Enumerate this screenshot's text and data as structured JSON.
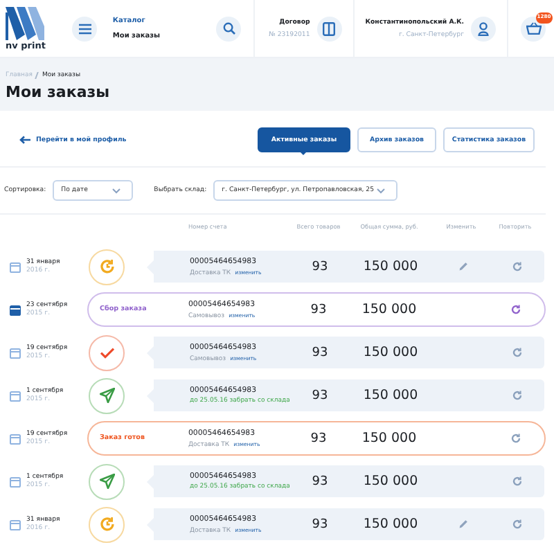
{
  "header": {
    "logo_text": "nv print",
    "nav_link": "Каталог",
    "nav_title": "Мои заказы",
    "contract": {
      "label": "Договор",
      "number": "№ 23192011"
    },
    "user": {
      "name": "Константинопольский А.К.",
      "city": "г. Санкт-Петербург"
    },
    "cart_badge": "1280"
  },
  "breadcrumb": [
    {
      "label": "Главная",
      "link": true
    },
    {
      "label": "Мои заказы",
      "link": false
    }
  ],
  "page_title": "Мои заказы",
  "profile_link": "Перейти в мой профиль",
  "tabs": [
    {
      "label": "Активные заказы",
      "selected": true
    },
    {
      "label": "Архив заказов",
      "selected": false
    },
    {
      "label": "Статистика заказов",
      "selected": false
    }
  ],
  "filters": [
    {
      "label": "Сортировка:",
      "value": "По дате"
    },
    {
      "label": "Выбрать склад:",
      "value": "г. Санкт-Петербург, ул. Петропавловская, 25"
    }
  ],
  "columns": [
    "Номер счета",
    "Всего товаров",
    "Общая сумма, руб.",
    "Изменить",
    "Повторить"
  ],
  "rows": [
    {
      "date": "31 января",
      "year": "2016 г.",
      "status": {
        "kind": "in_progress"
      },
      "number": "00005464654983",
      "delivery": {
        "kind": "transport",
        "text": "Доставка ТК",
        "link": "изменить"
      },
      "qty": "93",
      "sum": "150 000",
      "editable": true,
      "selected": false
    },
    {
      "date": "23 сентября",
      "year": "2015 г.",
      "status": {
        "kind": "collecting",
        "label": "Сбор заказа"
      },
      "number": "00005464654983",
      "delivery": {
        "kind": "pickup",
        "text": "Самовывоз",
        "link": "изменить"
      },
      "qty": "93",
      "sum": "150 000",
      "editable": false,
      "selected": true
    },
    {
      "date": "19 сентября",
      "year": "2015 г.",
      "status": {
        "kind": "done"
      },
      "number": "00005464654983",
      "delivery": {
        "kind": "pickup",
        "text": "Самовывоз",
        "link": "изменить"
      },
      "qty": "93",
      "sum": "150 000",
      "editable": false,
      "selected": false
    },
    {
      "date": "1 сентября",
      "year": "2015 г.",
      "status": {
        "kind": "shipped"
      },
      "number": "00005464654983",
      "delivery": {
        "kind": "deadline",
        "text": "до 25.05.16 забрать со склада"
      },
      "qty": "93",
      "sum": "150 000",
      "editable": false,
      "selected": false
    },
    {
      "date": "19 сентября",
      "year": "2015 г.",
      "status": {
        "kind": "ready",
        "label": "Заказ готов"
      },
      "number": "00005464654983",
      "delivery": {
        "kind": "transport",
        "text": "Доставка ТК",
        "link": "изменить"
      },
      "qty": "93",
      "sum": "150 000",
      "editable": false,
      "selected": false
    },
    {
      "date": "1 сентября",
      "year": "2015 г.",
      "status": {
        "kind": "shipped"
      },
      "number": "00005464654983",
      "delivery": {
        "kind": "deadline",
        "text": "до 25.05.16 забрать со склада"
      },
      "qty": "93",
      "sum": "150 000",
      "editable": false,
      "selected": false
    },
    {
      "date": "31 января",
      "year": "2016 г.",
      "status": {
        "kind": "in_progress"
      },
      "number": "00005464654983",
      "delivery": {
        "kind": "transport",
        "text": "Доставка ТК",
        "link": "изменить"
      },
      "qty": "93",
      "sum": "150 000",
      "editable": true,
      "selected": false
    }
  ]
}
